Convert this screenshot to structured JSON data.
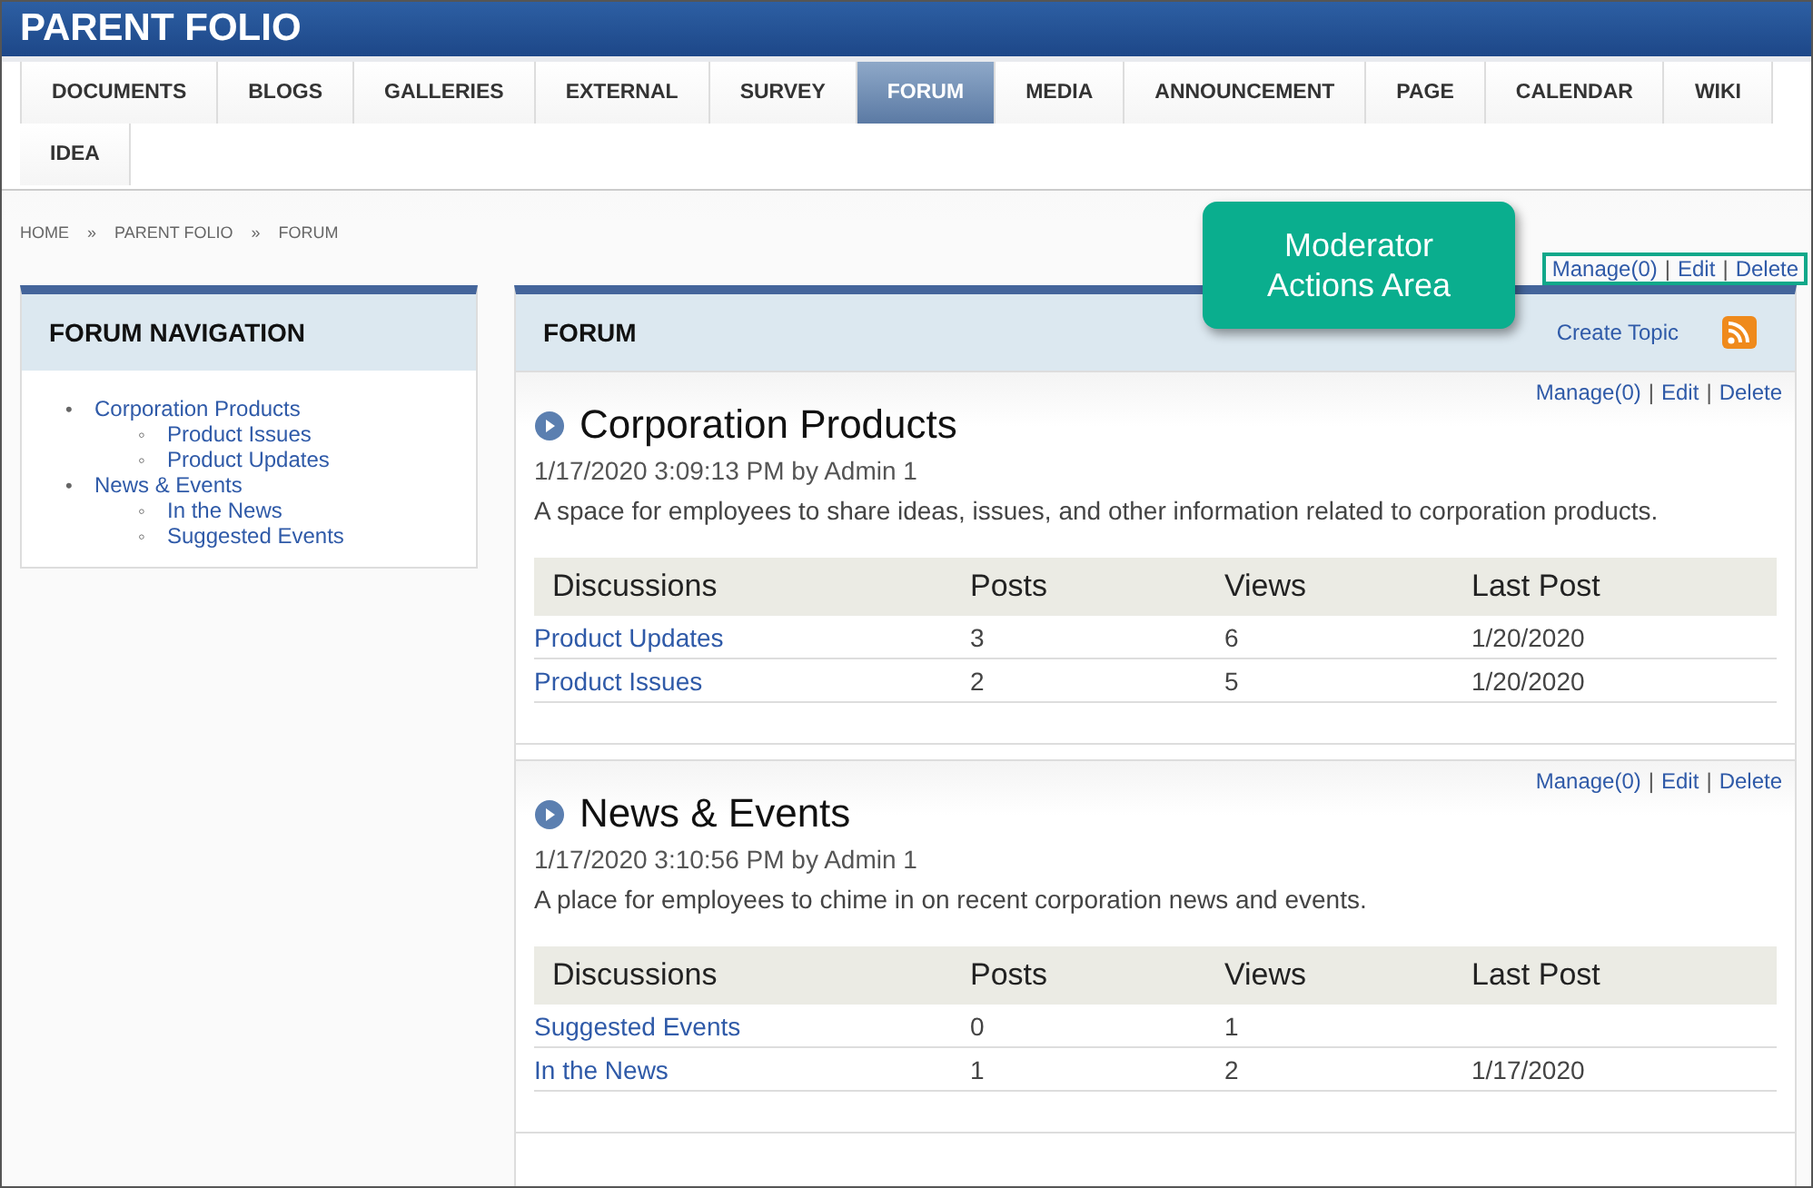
{
  "header": {
    "title": "PARENT FOLIO"
  },
  "tabs": [
    {
      "label": "DOCUMENTS",
      "selected": false
    },
    {
      "label": "BLOGS",
      "selected": false
    },
    {
      "label": "GALLERIES",
      "selected": false
    },
    {
      "label": "EXTERNAL",
      "selected": false
    },
    {
      "label": "SURVEY",
      "selected": false
    },
    {
      "label": "FORUM",
      "selected": true
    },
    {
      "label": "MEDIA",
      "selected": false
    },
    {
      "label": "ANNOUNCEMENT",
      "selected": false
    },
    {
      "label": "PAGE",
      "selected": false
    },
    {
      "label": "CALENDAR",
      "selected": false
    },
    {
      "label": "WIKI",
      "selected": false
    },
    {
      "label": "IDEA",
      "selected": false
    }
  ],
  "breadcrumb": {
    "items": [
      "HOME",
      "PARENT FOLIO",
      "FORUM"
    ],
    "separator": "»"
  },
  "callout": {
    "text": "Moderator Actions Area"
  },
  "moderator_actions": {
    "links": [
      "Manage(0)",
      "Edit",
      "Delete"
    ],
    "separator": "|",
    "highlighted": true
  },
  "navigation": {
    "title": "FORUM NAVIGATION",
    "bullet": "•",
    "child_bullet": "◦",
    "items": [
      {
        "label": "Corporation Products",
        "children": [
          {
            "label": "Product Issues"
          },
          {
            "label": "Product Updates"
          }
        ]
      },
      {
        "label": "News & Events",
        "children": [
          {
            "label": "In the News"
          },
          {
            "label": "Suggested Events"
          }
        ]
      }
    ]
  },
  "forum": {
    "title": "FORUM",
    "create_topic": "Create Topic",
    "categories": [
      {
        "title": "Corporation Products",
        "meta": "1/17/2020 3:09:13 PM by Admin 1",
        "description": "A space for employees to share ideas, issues, and other information related to corporation products.",
        "actions": [
          "Manage(0)",
          "Edit",
          "Delete"
        ],
        "columns": [
          "Discussions",
          "Posts",
          "Views",
          "Last Post"
        ],
        "rows": [
          {
            "cells": [
              "Product Updates",
              "3",
              "6",
              "1/20/2020"
            ]
          },
          {
            "cells": [
              "Product Issues",
              "2",
              "5",
              "1/20/2020"
            ]
          }
        ]
      },
      {
        "title": "News & Events",
        "meta": "1/17/2020 3:10:56 PM by Admin 1",
        "description": "A place for employees to chime in on recent corporation news and events.",
        "actions": [
          "Manage(0)",
          "Edit",
          "Delete"
        ],
        "columns": [
          "Discussions",
          "Posts",
          "Views",
          "Last Post"
        ],
        "rows": [
          {
            "cells": [
              "Suggested Events",
              "0",
              "1"
            ]
          },
          {
            "cells": [
              "In the News",
              "1",
              "2",
              "1/17/2020"
            ]
          }
        ]
      }
    ]
  }
}
